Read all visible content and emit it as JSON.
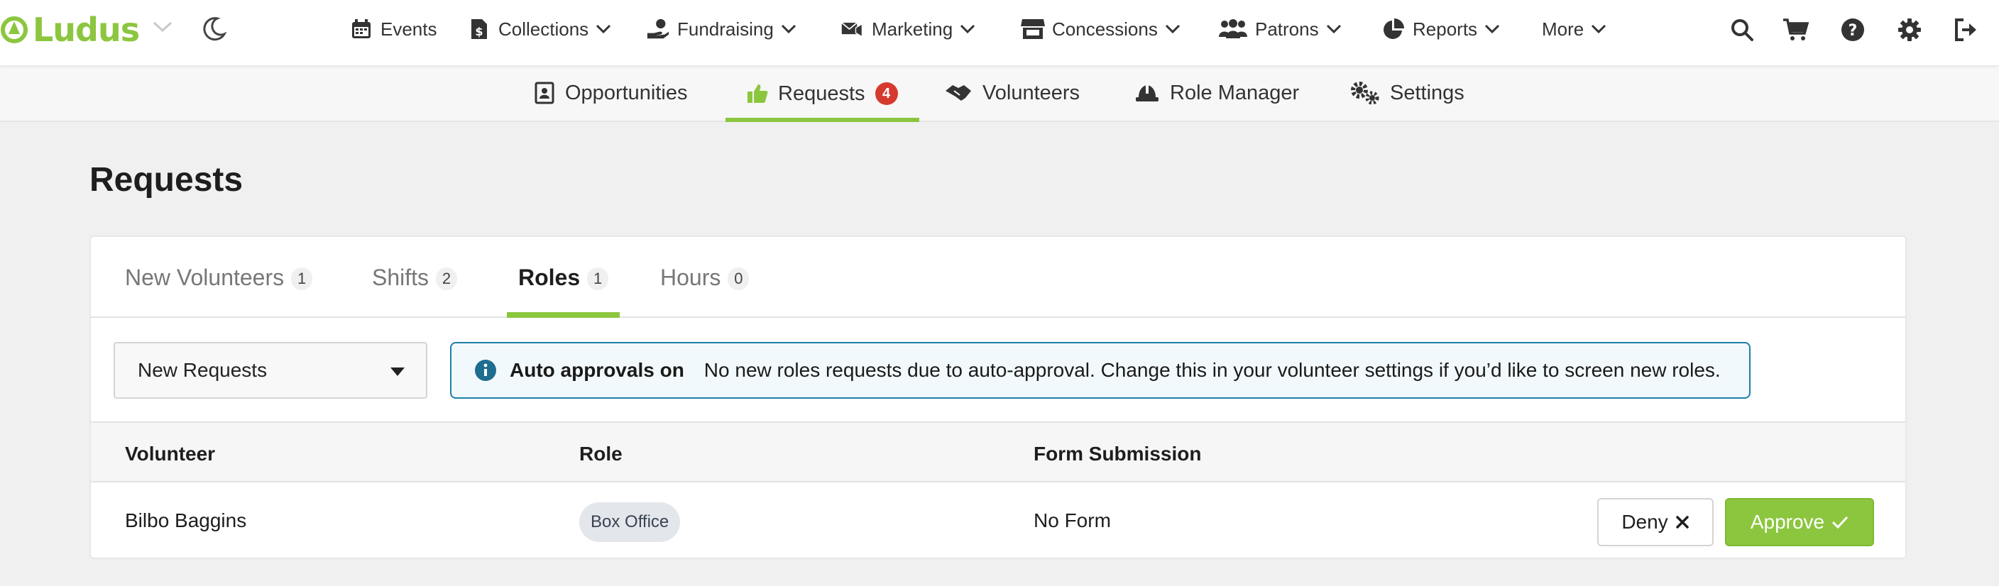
{
  "app": {
    "name": "Ludus",
    "brand_color": "#8cc63f"
  },
  "topnav": {
    "items": [
      {
        "label": "Events",
        "icon": "calendar-icon"
      },
      {
        "label": "Collections",
        "icon": "dollar-document-icon"
      },
      {
        "label": "Fundraising",
        "icon": "hand-coin-icon"
      },
      {
        "label": "Marketing",
        "icon": "mail-bullhorn-icon"
      },
      {
        "label": "Concessions",
        "icon": "storefront-icon"
      },
      {
        "label": "Patrons",
        "icon": "people-icon"
      },
      {
        "label": "Reports",
        "icon": "pie-chart-icon"
      },
      {
        "label": "More",
        "icon": "chevron-down-icon"
      }
    ],
    "right_icons": [
      "search-icon",
      "cart-icon",
      "help-icon",
      "gear-icon",
      "logout-icon"
    ]
  },
  "subnav": {
    "items": [
      {
        "label": "Opportunities",
        "icon": "contact-card-icon"
      },
      {
        "label": "Requests",
        "icon": "thumbs-up-icon",
        "badge": "4",
        "active": true
      },
      {
        "label": "Volunteers",
        "icon": "handshake-icon"
      },
      {
        "label": "Role Manager",
        "icon": "hard-hat-icon"
      },
      {
        "label": "Settings",
        "icon": "gears-icon"
      }
    ]
  },
  "page": {
    "title": "Requests"
  },
  "tabs": [
    {
      "label": "New Volunteers",
      "count": "1"
    },
    {
      "label": "Shifts",
      "count": "2"
    },
    {
      "label": "Roles",
      "count": "1",
      "active": true
    },
    {
      "label": "Hours",
      "count": "0"
    }
  ],
  "filter": {
    "selected": "New Requests"
  },
  "alert": {
    "title": "Auto approvals on",
    "message": "No new roles requests due to auto-approval. Change this in your volunteer settings if you’d like to screen new roles.",
    "color": "#1f7fa8"
  },
  "table": {
    "columns": [
      "Volunteer",
      "Role",
      "Form Submission"
    ],
    "rows": [
      {
        "volunteer": "Bilbo Baggins",
        "role": "Box Office",
        "form": "No Form"
      }
    ],
    "deny_label": "Deny",
    "approve_label": "Approve"
  }
}
